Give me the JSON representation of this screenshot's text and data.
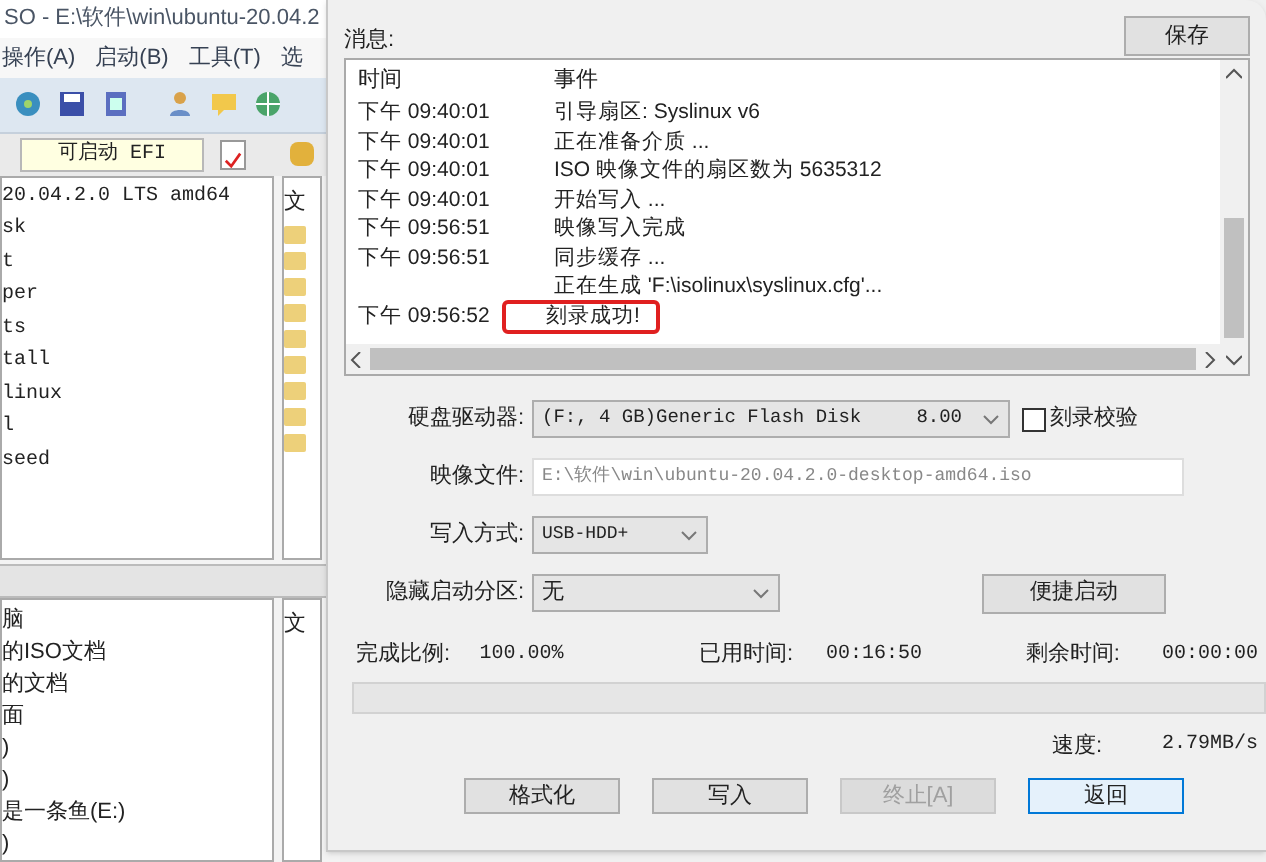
{
  "background_window": {
    "title": "SO - E:\\软件\\win\\ubuntu-20.04.2",
    "menu": [
      "操作(A)",
      "启动(B)",
      "工具(T)",
      "选"
    ],
    "boot_field": "可启动 EFI",
    "tree_items": [
      "20.04.2.0 LTS amd64",
      "sk",
      "t",
      "per",
      "ts",
      "tall",
      "linux",
      "l",
      "seed"
    ],
    "file_column_header": "文",
    "lower_header": "文",
    "lower_items": [
      "脑",
      "的ISO文档",
      "的文档",
      "面",
      ")",
      ")",
      "是一条鱼(E:)",
      ")"
    ]
  },
  "dialog": {
    "messages_label": "消息:",
    "save_button": "保存",
    "log": {
      "columns": [
        "时间",
        "事件"
      ],
      "rows": [
        {
          "time": "下午 09:40:01",
          "event": "引导扇区: Syslinux v6",
          "highlighted": false
        },
        {
          "time": "下午 09:40:01",
          "event": "正在准备介质 ...",
          "highlighted": false
        },
        {
          "time": "下午 09:40:01",
          "event": "ISO 映像文件的扇区数为 5635312",
          "highlighted": false
        },
        {
          "time": "下午 09:40:01",
          "event": "开始写入 ...",
          "highlighted": false
        },
        {
          "time": "下午 09:56:51",
          "event": "映像写入完成",
          "highlighted": false
        },
        {
          "time": "下午 09:56:51",
          "event": "同步缓存 ...",
          "highlighted": false
        },
        {
          "event": "正在生成 'F:\\isolinux\\syslinux.cfg'...",
          "highlighted": false
        },
        {
          "time": "下午 09:56:52",
          "event": "刻录成功!",
          "highlighted": true
        }
      ]
    },
    "disk_drive": {
      "label": "硬盘驱动器:",
      "value": "(F:, 4 GB)Generic Flash Disk",
      "size": "8.00"
    },
    "verify": {
      "label": "刻录校验",
      "checked": false
    },
    "image_file": {
      "label": "映像文件:",
      "disabled": true,
      "value": "E:\\软件\\win\\ubuntu-20.04.2.0-desktop-amd64.iso"
    },
    "write_mode": {
      "label": "写入方式:",
      "value": "USB-HDD+"
    },
    "hidden_partition": {
      "label": "隐藏启动分区:",
      "value": "无"
    },
    "quick_boot_button": "便捷启动",
    "stats": [
      {
        "label": "完成比例:",
        "value": "100.00%"
      },
      {
        "label": "已用时间:",
        "value": "00:16:50"
      },
      {
        "label": "剩余时间:",
        "value": "00:00:00"
      }
    ],
    "progress": {
      "level": 0
    },
    "speed": {
      "label": "速度:",
      "value": "2.79MB/s"
    },
    "buttons": [
      {
        "label": "格式化",
        "disabled": false,
        "focused": false
      },
      {
        "label": "写入",
        "disabled": false,
        "focused": false
      },
      {
        "label": "终止[A]",
        "disabled": true,
        "focused": false
      },
      {
        "label": "返回",
        "disabled": false,
        "focused": true
      }
    ]
  }
}
